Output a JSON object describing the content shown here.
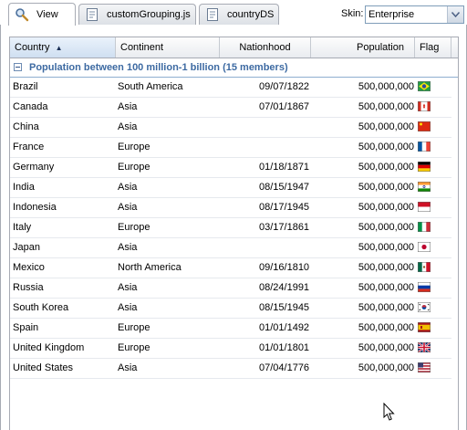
{
  "tabs": [
    {
      "label": "View",
      "icon": "search-icon"
    },
    {
      "label": "customGrouping.js",
      "icon": "js-file-icon"
    },
    {
      "label": "countryDS",
      "icon": "datasource-file-icon"
    }
  ],
  "skin": {
    "label": "Skin:",
    "value": "Enterprise"
  },
  "grid": {
    "columns": [
      "Country",
      "Continent",
      "Nationhood",
      "Population",
      "Flag"
    ],
    "sort_indicator": "▲",
    "group_title": "Population between 100 million-1 billion (15 members)",
    "rows": [
      {
        "country": "Brazil",
        "continent": "South America",
        "nationhood": "09/07/1822",
        "population": "500,000,000",
        "flag": "br"
      },
      {
        "country": "Canada",
        "continent": "Asia",
        "nationhood": "07/01/1867",
        "population": "500,000,000",
        "flag": "ca"
      },
      {
        "country": "China",
        "continent": "Asia",
        "nationhood": "",
        "population": "500,000,000",
        "flag": "cn"
      },
      {
        "country": "France",
        "continent": "Europe",
        "nationhood": "",
        "population": "500,000,000",
        "flag": "fr"
      },
      {
        "country": "Germany",
        "continent": "Europe",
        "nationhood": "01/18/1871",
        "population": "500,000,000",
        "flag": "de"
      },
      {
        "country": "India",
        "continent": "Asia",
        "nationhood": "08/15/1947",
        "population": "500,000,000",
        "flag": "in"
      },
      {
        "country": "Indonesia",
        "continent": "Asia",
        "nationhood": "08/17/1945",
        "population": "500,000,000",
        "flag": "id"
      },
      {
        "country": "Italy",
        "continent": "Europe",
        "nationhood": "03/17/1861",
        "population": "500,000,000",
        "flag": "it"
      },
      {
        "country": "Japan",
        "continent": "Asia",
        "nationhood": "",
        "population": "500,000,000",
        "flag": "jp"
      },
      {
        "country": "Mexico",
        "continent": "North America",
        "nationhood": "09/16/1810",
        "population": "500,000,000",
        "flag": "mx"
      },
      {
        "country": "Russia",
        "continent": "Asia",
        "nationhood": "08/24/1991",
        "population": "500,000,000",
        "flag": "ru"
      },
      {
        "country": "South Korea",
        "continent": "Asia",
        "nationhood": "08/15/1945",
        "population": "500,000,000",
        "flag": "kr"
      },
      {
        "country": "Spain",
        "continent": "Europe",
        "nationhood": "01/01/1492",
        "population": "500,000,000",
        "flag": "es"
      },
      {
        "country": "United Kingdom",
        "continent": "Europe",
        "nationhood": "01/01/1801",
        "population": "500,000,000",
        "flag": "gb"
      },
      {
        "country": "United States",
        "continent": "Asia",
        "nationhood": "07/04/1776",
        "population": "500,000,000",
        "flag": "us"
      }
    ]
  },
  "colors": {
    "accent": "#3d6aa2",
    "border": "#a7abb4",
    "header_sorted": "#cfdff1"
  }
}
